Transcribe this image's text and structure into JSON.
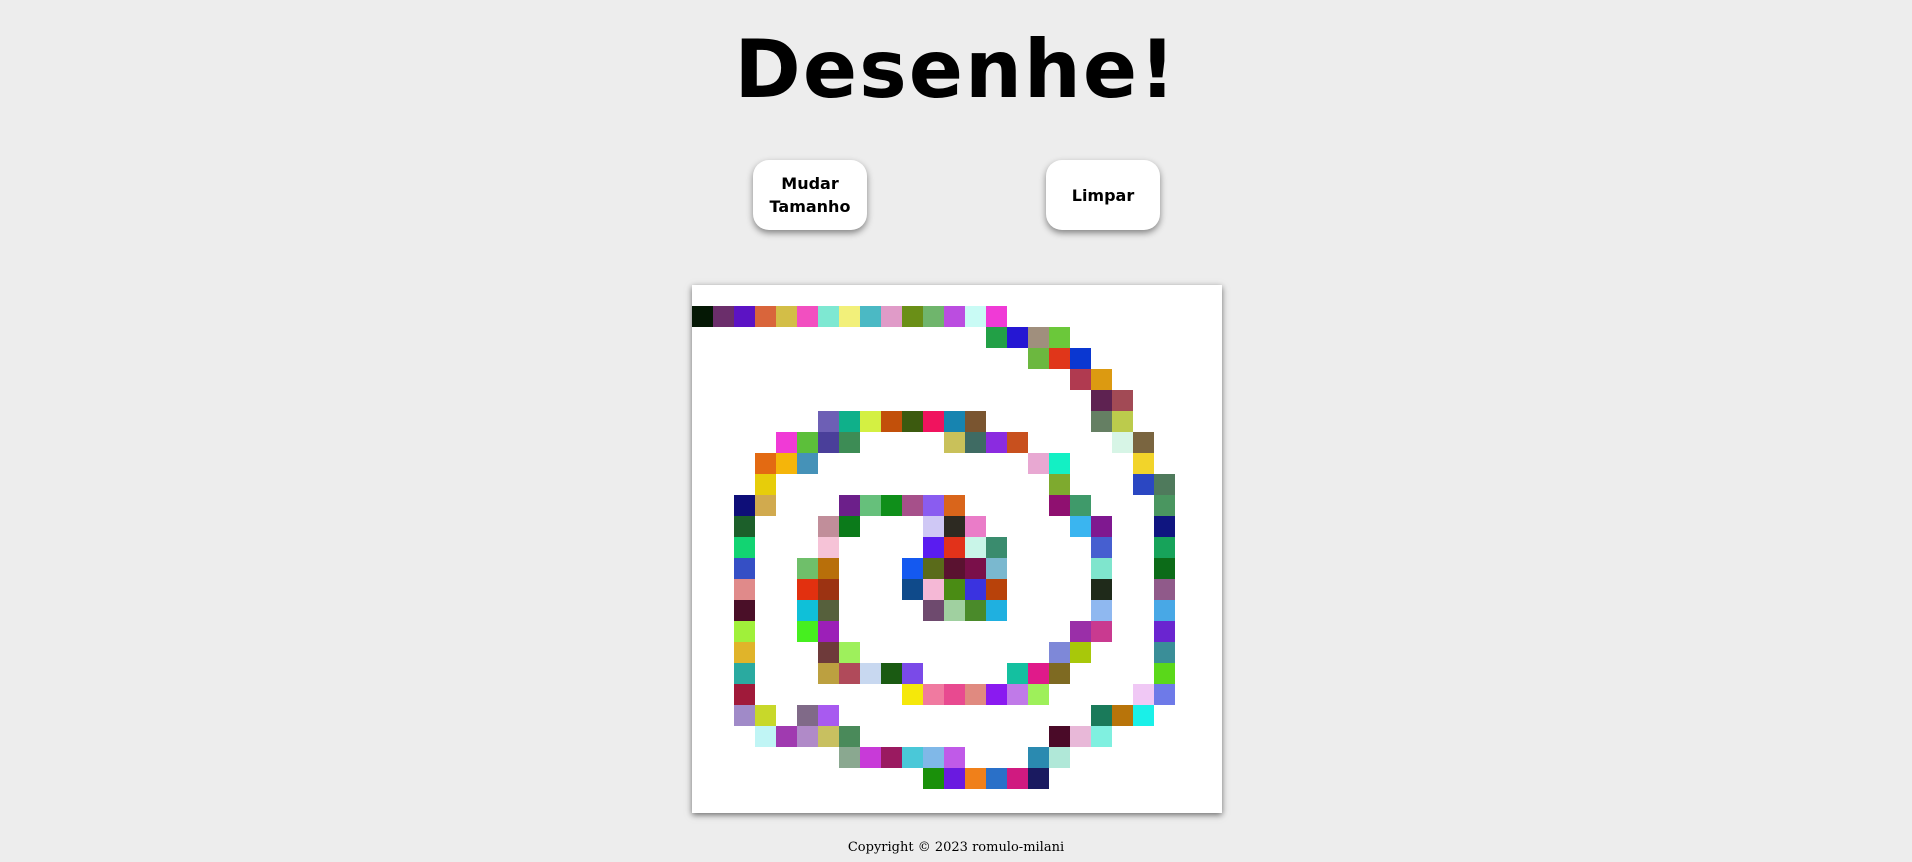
{
  "page": {
    "title": "Desenhe!",
    "footer": "Copyright © 2023 romulo-milani"
  },
  "controls": {
    "resize_label": "Mudar Tamanho",
    "clear_label": "Limpar"
  },
  "board": {
    "background": "#ffffff",
    "grid_columns": 25,
    "grid_rows": 25,
    "painted_cells": [
      {
        "col": 0,
        "row": 1,
        "color": "#051805"
      },
      {
        "col": 1,
        "row": 1,
        "color": "#6b2e6b"
      },
      {
        "col": 2,
        "row": 1,
        "color": "#5c13c4"
      },
      {
        "col": 3,
        "row": 1,
        "color": "#d9653b"
      },
      {
        "col": 4,
        "row": 1,
        "color": "#d3be47"
      },
      {
        "col": 5,
        "row": 1,
        "color": "#f24fc0"
      },
      {
        "col": 6,
        "row": 1,
        "color": "#7ee8d2"
      },
      {
        "col": 7,
        "row": 1,
        "color": "#f2f07a"
      },
      {
        "col": 8,
        "row": 1,
        "color": "#4bb9c4"
      },
      {
        "col": 9,
        "row": 1,
        "color": "#e09bc8"
      },
      {
        "col": 10,
        "row": 1,
        "color": "#6a8f17"
      },
      {
        "col": 11,
        "row": 1,
        "color": "#6fb56c"
      },
      {
        "col": 12,
        "row": 1,
        "color": "#bb4de0"
      },
      {
        "col": 13,
        "row": 1,
        "color": "#c9fbf5"
      },
      {
        "col": 14,
        "row": 1,
        "color": "#f03ad6"
      },
      {
        "col": 14,
        "row": 2,
        "color": "#22a046"
      },
      {
        "col": 15,
        "row": 2,
        "color": "#2517d3"
      },
      {
        "col": 16,
        "row": 2,
        "color": "#a08f7d"
      },
      {
        "col": 17,
        "row": 2,
        "color": "#6bc83a"
      },
      {
        "col": 16,
        "row": 3,
        "color": "#6cb83f"
      },
      {
        "col": 17,
        "row": 3,
        "color": "#e0361a"
      },
      {
        "col": 18,
        "row": 3,
        "color": "#0a37d1"
      },
      {
        "col": 18,
        "row": 4,
        "color": "#b03a50"
      },
      {
        "col": 19,
        "row": 4,
        "color": "#dc9a11"
      },
      {
        "col": 19,
        "row": 5,
        "color": "#5e2251"
      },
      {
        "col": 20,
        "row": 5,
        "color": "#a24a55"
      },
      {
        "col": 6,
        "row": 6,
        "color": "#6d5fb5"
      },
      {
        "col": 7,
        "row": 6,
        "color": "#0fb08a"
      },
      {
        "col": 8,
        "row": 6,
        "color": "#d4f042"
      },
      {
        "col": 9,
        "row": 6,
        "color": "#c2500a"
      },
      {
        "col": 10,
        "row": 6,
        "color": "#3c5a0f"
      },
      {
        "col": 11,
        "row": 6,
        "color": "#f0135e"
      },
      {
        "col": 12,
        "row": 6,
        "color": "#1784b0"
      },
      {
        "col": 13,
        "row": 6,
        "color": "#7a5530"
      },
      {
        "col": 19,
        "row": 6,
        "color": "#657f63"
      },
      {
        "col": 20,
        "row": 6,
        "color": "#bccb4c"
      },
      {
        "col": 4,
        "row": 7,
        "color": "#f03ad6"
      },
      {
        "col": 5,
        "row": 7,
        "color": "#5cbf3a"
      },
      {
        "col": 6,
        "row": 7,
        "color": "#4a3f9a"
      },
      {
        "col": 7,
        "row": 7,
        "color": "#3d8c55"
      },
      {
        "col": 12,
        "row": 7,
        "color": "#c9c15a"
      },
      {
        "col": 13,
        "row": 7,
        "color": "#3f6b63"
      },
      {
        "col": 14,
        "row": 7,
        "color": "#8b2be0"
      },
      {
        "col": 15,
        "row": 7,
        "color": "#c8501e"
      },
      {
        "col": 20,
        "row": 7,
        "color": "#d7f5e6"
      },
      {
        "col": 21,
        "row": 7,
        "color": "#7a6540"
      },
      {
        "col": 3,
        "row": 8,
        "color": "#e36a12"
      },
      {
        "col": 4,
        "row": 8,
        "color": "#f5b50a"
      },
      {
        "col": 5,
        "row": 8,
        "color": "#4592b8"
      },
      {
        "col": 16,
        "row": 8,
        "color": "#e8a8d2"
      },
      {
        "col": 17,
        "row": 8,
        "color": "#13f0c4"
      },
      {
        "col": 21,
        "row": 8,
        "color": "#f2d42a"
      },
      {
        "col": 3,
        "row": 9,
        "color": "#e7cd0a"
      },
      {
        "col": 17,
        "row": 9,
        "color": "#7eaa2e"
      },
      {
        "col": 21,
        "row": 9,
        "color": "#2b47c2"
      },
      {
        "col": 22,
        "row": 9,
        "color": "#4f7a5c"
      },
      {
        "col": 2,
        "row": 10,
        "color": "#0e0e78"
      },
      {
        "col": 3,
        "row": 10,
        "color": "#d1aa4e"
      },
      {
        "col": 7,
        "row": 10,
        "color": "#6c1f8a"
      },
      {
        "col": 8,
        "row": 10,
        "color": "#66c07b"
      },
      {
        "col": 9,
        "row": 10,
        "color": "#0f8f1a"
      },
      {
        "col": 10,
        "row": 10,
        "color": "#a6508a"
      },
      {
        "col": 11,
        "row": 10,
        "color": "#8a5cf0"
      },
      {
        "col": 12,
        "row": 10,
        "color": "#d9651b"
      },
      {
        "col": 17,
        "row": 10,
        "color": "#8f1070"
      },
      {
        "col": 18,
        "row": 10,
        "color": "#3f9a6a"
      },
      {
        "col": 22,
        "row": 10,
        "color": "#4a9660"
      },
      {
        "col": 2,
        "row": 11,
        "color": "#1c5f2a"
      },
      {
        "col": 6,
        "row": 11,
        "color": "#c18e9a"
      },
      {
        "col": 7,
        "row": 11,
        "color": "#0b7a1a"
      },
      {
        "col": 11,
        "row": 11,
        "color": "#cfc8f5"
      },
      {
        "col": 12,
        "row": 11,
        "color": "#2d2a22"
      },
      {
        "col": 13,
        "row": 11,
        "color": "#ea7cc8"
      },
      {
        "col": 18,
        "row": 11,
        "color": "#3ab5f0"
      },
      {
        "col": 19,
        "row": 11,
        "color": "#7f1890"
      },
      {
        "col": 22,
        "row": 11,
        "color": "#0f1580"
      },
      {
        "col": 2,
        "row": 12,
        "color": "#12d472"
      },
      {
        "col": 6,
        "row": 12,
        "color": "#f6c3d7"
      },
      {
        "col": 11,
        "row": 12,
        "color": "#5a1cf0"
      },
      {
        "col": 12,
        "row": 12,
        "color": "#e2321a"
      },
      {
        "col": 13,
        "row": 12,
        "color": "#c9f5e8"
      },
      {
        "col": 14,
        "row": 12,
        "color": "#3a8c6e"
      },
      {
        "col": 19,
        "row": 12,
        "color": "#465fd0"
      },
      {
        "col": 22,
        "row": 12,
        "color": "#17a35a"
      },
      {
        "col": 2,
        "row": 13,
        "color": "#354fc5"
      },
      {
        "col": 5,
        "row": 13,
        "color": "#6fbf6a"
      },
      {
        "col": 6,
        "row": 13,
        "color": "#b86f0a"
      },
      {
        "col": 10,
        "row": 13,
        "color": "#1459f0"
      },
      {
        "col": 11,
        "row": 13,
        "color": "#5a6b1a"
      },
      {
        "col": 12,
        "row": 13,
        "color": "#5a1230"
      },
      {
        "col": 13,
        "row": 13,
        "color": "#7a0f4a"
      },
      {
        "col": 14,
        "row": 13,
        "color": "#7ab8cf"
      },
      {
        "col": 19,
        "row": 13,
        "color": "#7fe5cd"
      },
      {
        "col": 22,
        "row": 13,
        "color": "#0c6b18"
      },
      {
        "col": 2,
        "row": 14,
        "color": "#e08a8a"
      },
      {
        "col": 5,
        "row": 14,
        "color": "#e2300f"
      },
      {
        "col": 6,
        "row": 14,
        "color": "#9c3312"
      },
      {
        "col": 10,
        "row": 14,
        "color": "#0f4a8a"
      },
      {
        "col": 11,
        "row": 14,
        "color": "#f5b8d6"
      },
      {
        "col": 12,
        "row": 14,
        "color": "#4a8c14"
      },
      {
        "col": 13,
        "row": 14,
        "color": "#3a33e0"
      },
      {
        "col": 14,
        "row": 14,
        "color": "#b8420a"
      },
      {
        "col": 19,
        "row": 14,
        "color": "#1f2a1a"
      },
      {
        "col": 22,
        "row": 14,
        "color": "#905a8a"
      },
      {
        "col": 2,
        "row": 15,
        "color": "#4a0f28"
      },
      {
        "col": 5,
        "row": 15,
        "color": "#0fc0d8"
      },
      {
        "col": 6,
        "row": 15,
        "color": "#56603c"
      },
      {
        "col": 11,
        "row": 15,
        "color": "#6e4a6e"
      },
      {
        "col": 12,
        "row": 15,
        "color": "#a0d0a0"
      },
      {
        "col": 13,
        "row": 15,
        "color": "#4a8a2a"
      },
      {
        "col": 14,
        "row": 15,
        "color": "#1fb0e0"
      },
      {
        "col": 19,
        "row": 15,
        "color": "#8fb8f0"
      },
      {
        "col": 22,
        "row": 15,
        "color": "#48a8e6"
      },
      {
        "col": 2,
        "row": 16,
        "color": "#a0f03a"
      },
      {
        "col": 5,
        "row": 16,
        "color": "#46ef1f"
      },
      {
        "col": 6,
        "row": 16,
        "color": "#9c1fb8"
      },
      {
        "col": 18,
        "row": 16,
        "color": "#9a2fa8"
      },
      {
        "col": 19,
        "row": 16,
        "color": "#c93a90"
      },
      {
        "col": 22,
        "row": 16,
        "color": "#6a25d0"
      },
      {
        "col": 2,
        "row": 17,
        "color": "#e0b42a"
      },
      {
        "col": 6,
        "row": 17,
        "color": "#6e3a3a"
      },
      {
        "col": 7,
        "row": 17,
        "color": "#9ef05c"
      },
      {
        "col": 17,
        "row": 17,
        "color": "#7e88d8"
      },
      {
        "col": 18,
        "row": 17,
        "color": "#a8c80a"
      },
      {
        "col": 22,
        "row": 17,
        "color": "#3a8e98"
      },
      {
        "col": 2,
        "row": 18,
        "color": "#2aaaa0"
      },
      {
        "col": 6,
        "row": 18,
        "color": "#bca040"
      },
      {
        "col": 7,
        "row": 18,
        "color": "#b04a5a"
      },
      {
        "col": 8,
        "row": 18,
        "color": "#c8d8f0"
      },
      {
        "col": 9,
        "row": 18,
        "color": "#1a5a12"
      },
      {
        "col": 10,
        "row": 18,
        "color": "#7a4ae8"
      },
      {
        "col": 15,
        "row": 18,
        "color": "#14c0a0"
      },
      {
        "col": 16,
        "row": 18,
        "color": "#e01a8a"
      },
      {
        "col": 17,
        "row": 18,
        "color": "#7e6a22"
      },
      {
        "col": 22,
        "row": 18,
        "color": "#5ad81a"
      },
      {
        "col": 2,
        "row": 19,
        "color": "#a01a3a"
      },
      {
        "col": 10,
        "row": 19,
        "color": "#f5e80a"
      },
      {
        "col": 11,
        "row": 19,
        "color": "#f07aa0"
      },
      {
        "col": 12,
        "row": 19,
        "color": "#e84a90"
      },
      {
        "col": 13,
        "row": 19,
        "color": "#e08a80"
      },
      {
        "col": 14,
        "row": 19,
        "color": "#8a1af0"
      },
      {
        "col": 15,
        "row": 19,
        "color": "#c07ae8"
      },
      {
        "col": 16,
        "row": 19,
        "color": "#9ef05a"
      },
      {
        "col": 21,
        "row": 19,
        "color": "#f0c8f5"
      },
      {
        "col": 22,
        "row": 19,
        "color": "#6e7ae8"
      },
      {
        "col": 2,
        "row": 20,
        "color": "#a08ac8"
      },
      {
        "col": 3,
        "row": 20,
        "color": "#c8d82a"
      },
      {
        "col": 5,
        "row": 20,
        "color": "#806a88"
      },
      {
        "col": 6,
        "row": 20,
        "color": "#a85af0"
      },
      {
        "col": 19,
        "row": 20,
        "color": "#1a7a5a"
      },
      {
        "col": 20,
        "row": 20,
        "color": "#b8740a"
      },
      {
        "col": 21,
        "row": 20,
        "color": "#1af0e8"
      },
      {
        "col": 3,
        "row": 21,
        "color": "#c0f5f5"
      },
      {
        "col": 4,
        "row": 21,
        "color": "#a03ab0"
      },
      {
        "col": 5,
        "row": 21,
        "color": "#b08ac8"
      },
      {
        "col": 6,
        "row": 21,
        "color": "#c8c060"
      },
      {
        "col": 7,
        "row": 21,
        "color": "#4a8a5a"
      },
      {
        "col": 17,
        "row": 21,
        "color": "#4a0a28"
      },
      {
        "col": 18,
        "row": 21,
        "color": "#e8b8d8"
      },
      {
        "col": 19,
        "row": 21,
        "color": "#80f0e0"
      },
      {
        "col": 7,
        "row": 22,
        "color": "#8aa890"
      },
      {
        "col": 8,
        "row": 22,
        "color": "#c83ad8"
      },
      {
        "col": 9,
        "row": 22,
        "color": "#9a1a60"
      },
      {
        "col": 10,
        "row": 22,
        "color": "#4ac8d8"
      },
      {
        "col": 11,
        "row": 22,
        "color": "#80b8e8"
      },
      {
        "col": 12,
        "row": 22,
        "color": "#c05ae8"
      },
      {
        "col": 16,
        "row": 22,
        "color": "#2a8ab0"
      },
      {
        "col": 17,
        "row": 22,
        "color": "#b0e8d8"
      },
      {
        "col": 11,
        "row": 23,
        "color": "#1a900a"
      },
      {
        "col": 12,
        "row": 23,
        "color": "#6a1ae0"
      },
      {
        "col": 13,
        "row": 23,
        "color": "#f0801a"
      },
      {
        "col": 14,
        "row": 23,
        "color": "#2a70c8"
      },
      {
        "col": 15,
        "row": 23,
        "color": "#d01a80"
      },
      {
        "col": 16,
        "row": 23,
        "color": "#1a1a60"
      }
    ]
  }
}
